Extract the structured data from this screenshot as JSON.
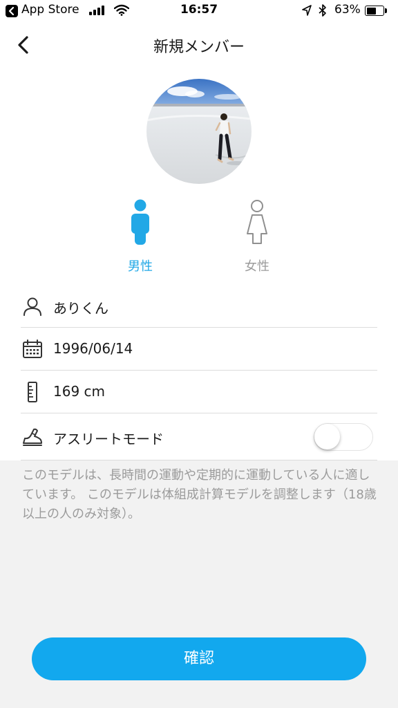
{
  "status_bar": {
    "back_app_label": "App Store",
    "time": "16:57",
    "battery_percent_text": "63%",
    "battery_level": 0.63,
    "signal_bars": 4
  },
  "nav": {
    "title": "新規メンバー",
    "back_icon": "chevron-left-icon"
  },
  "avatar": {
    "description_icon": "profile-photo"
  },
  "gender": {
    "options": [
      {
        "label": "男性",
        "icon": "male-icon",
        "selected": true,
        "color": "#22a8e6"
      },
      {
        "label": "女性",
        "icon": "female-icon",
        "selected": false,
        "color": "#9b9b9b"
      }
    ]
  },
  "form": {
    "name": {
      "icon": "person-icon",
      "value": "ありくん"
    },
    "birthday": {
      "icon": "calendar-icon",
      "value": "1996/06/14"
    },
    "height": {
      "icon": "ruler-icon",
      "value": "169 cm"
    },
    "athlete_mode": {
      "icon": "shoe-icon",
      "label": "アスリートモード",
      "enabled": false
    }
  },
  "description": "このモデルは、長時間の運動や定期的に運動している人に適しています。 このモデルは体組成計算モデルを調整します（18歳以上の人のみ対象）。",
  "confirm_button": {
    "label": "確認"
  },
  "colors": {
    "accent": "#12a8ee",
    "male_selected": "#22a8e6",
    "inactive": "#9b9b9b",
    "background_gray": "#f2f2f2"
  }
}
